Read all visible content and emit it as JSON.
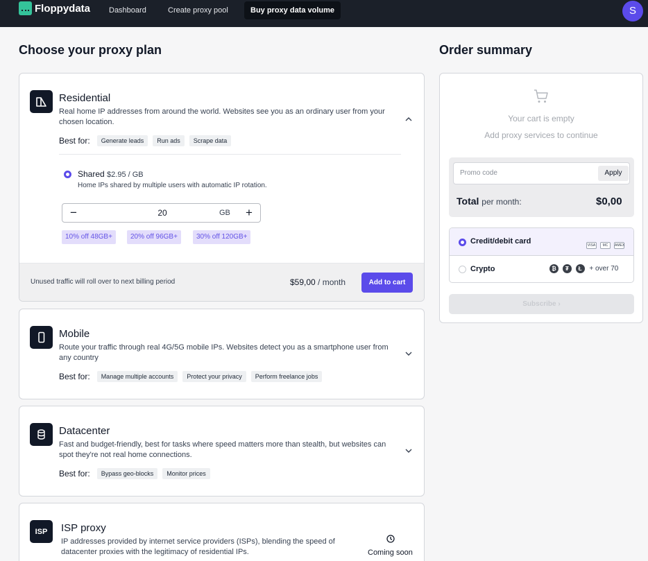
{
  "nav": {
    "brand": "Floppydata",
    "tabs": [
      "Dashboard",
      "Create proxy pool",
      "Buy proxy data volume"
    ],
    "active_tab": "Buy proxy data volume",
    "avatar_initial": "S"
  },
  "plans": {
    "heading": "Choose your proxy plan",
    "residential": {
      "title": "Residential",
      "description": "Real home IP addresses from around the world. Websites see you as an ordinary user from your chosen location.",
      "best_for_label": "Best for:",
      "tags": [
        "Generate leads",
        "Run ads",
        "Scrape data"
      ],
      "option_name": "Shared",
      "option_price": "$2.95 / GB",
      "option_description": "Home IPs shared by multiple users with automatic IP rotation.",
      "quantity": "20",
      "unit": "GB",
      "discounts": [
        "10% off 48GB+",
        "20% off 96GB+",
        "30% off 120GB+"
      ],
      "rollover_note": "Unused traffic will roll over to next billing period",
      "price_amount": "$59,00",
      "price_period": "/ month",
      "add_to_cart": "Add to cart"
    },
    "mobile": {
      "title": "Mobile",
      "description": "Route your traffic through real 4G/5G mobile IPs. Websites detect you as a smartphone user from any country",
      "best_for_label": "Best for:",
      "tags": [
        "Manage multiple accounts",
        "Protect your privacy",
        "Perform freelance jobs"
      ]
    },
    "datacenter": {
      "title": "Datacenter",
      "description": "Fast and budget-friendly, best for tasks where speed matters more than stealth, but websites can spot they're not real home connections.",
      "best_for_label": "Best for:",
      "tags": [
        "Bypass geo-blocks",
        "Monitor prices"
      ]
    },
    "isp": {
      "icon_text": "ISP",
      "title": "ISP proxy",
      "description": "IP addresses provided by internet service providers (ISPs), blending the speed of datacenter proxies with the legitimacy of residential IPs.",
      "status": "Coming soon"
    }
  },
  "summary": {
    "heading": "Order summary",
    "empty_title": "Your cart is empty",
    "empty_subtitle": "Add proxy services to continue",
    "promo_placeholder": "Promo code",
    "apply": "Apply",
    "total_label": "Total",
    "total_period": "per month:",
    "total_value": "$0,00",
    "payment_methods": [
      {
        "label": "Credit/debit card",
        "selected": true,
        "icons": [
          "VISA",
          "MC",
          "AMEX"
        ]
      },
      {
        "label": "Crypto",
        "selected": false,
        "icons": [
          "₿",
          "₮",
          "Ł"
        ],
        "extra": "+ over 70"
      }
    ],
    "subscribe": "Subscribe",
    "colors": {
      "accent": "#5b4bea",
      "nav_bg": "#1b2029"
    }
  }
}
